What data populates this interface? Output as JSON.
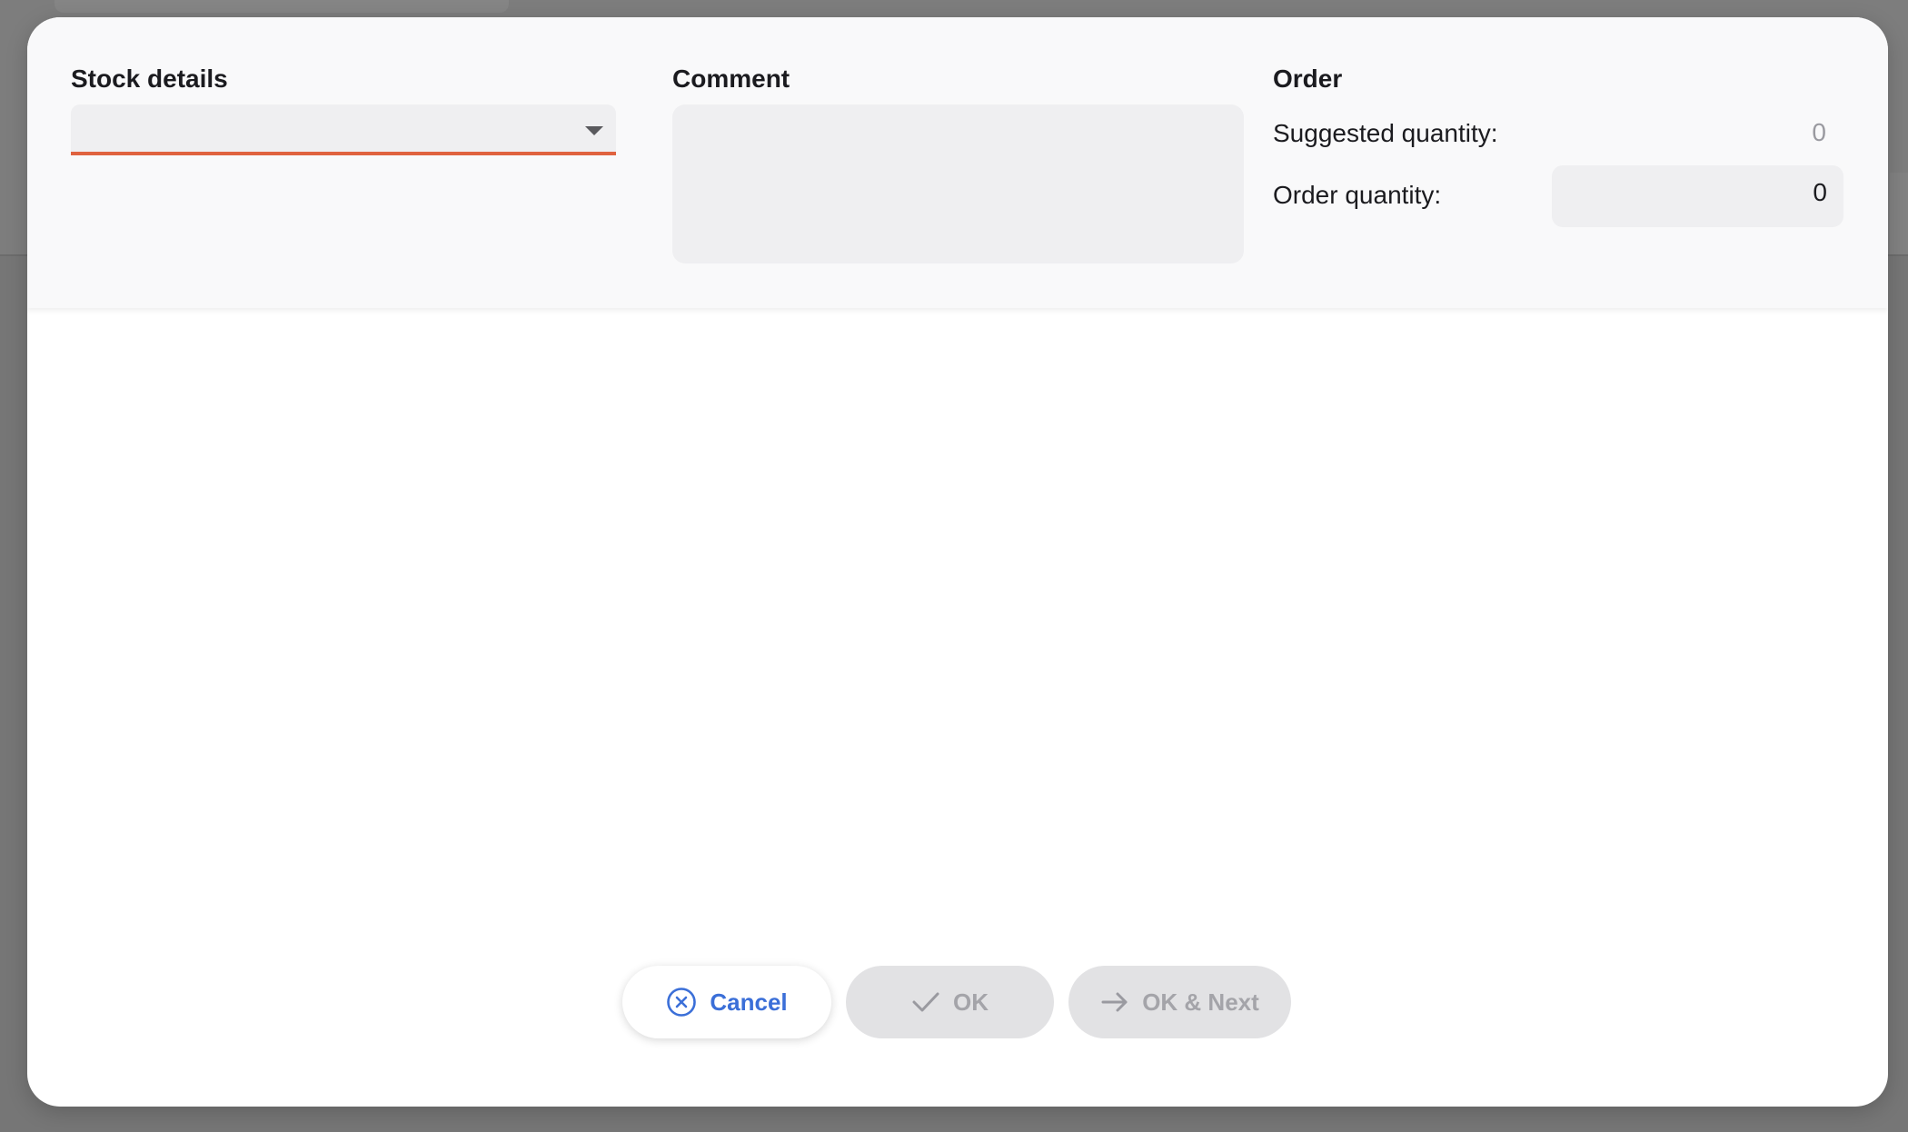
{
  "stock_details": {
    "title": "Stock details",
    "selected_value": ""
  },
  "comment": {
    "title": "Comment",
    "value": ""
  },
  "order": {
    "title": "Order",
    "suggested_label": "Suggested quantity:",
    "suggested_value": "0",
    "order_label": "Order quantity:",
    "order_value": "0"
  },
  "buttons": {
    "cancel": "Cancel",
    "ok": "OK",
    "ok_next": "OK & Next"
  },
  "icons": {
    "cancel": "close-circle-icon",
    "ok": "check-icon",
    "ok_next": "arrow-right-icon",
    "dropdown": "caret-down-icon"
  },
  "colors": {
    "accent": "#3b6fd8",
    "error_underline": "#e0623f",
    "disabled_text": "#a4a4a9"
  }
}
